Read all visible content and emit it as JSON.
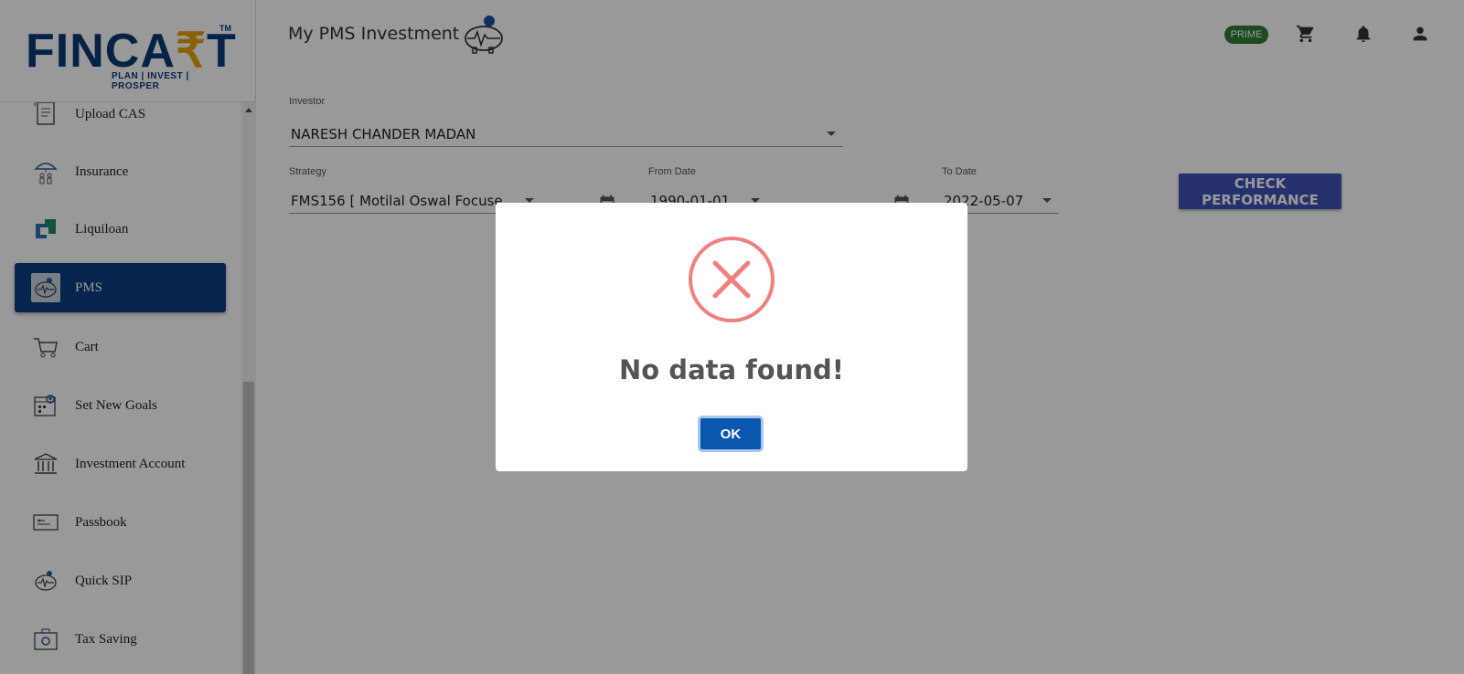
{
  "app": {
    "logo_text_main": "FINCA",
    "logo_text_accent": "₹",
    "logo_text_end": "T",
    "logo_tm": "TM",
    "logo_tagline": "PLAN | INVEST | PROSPER"
  },
  "sidebar": {
    "items": [
      {
        "label": "Upload CAS",
        "icon": "document-upload-icon"
      },
      {
        "label": "Insurance",
        "icon": "umbrella-family-icon"
      },
      {
        "label": "Liquiloan",
        "icon": "liquiloan-icon"
      },
      {
        "label": "PMS",
        "icon": "piggy-bank-icon",
        "active": true
      },
      {
        "label": "Cart",
        "icon": "cart-icon"
      },
      {
        "label": "Set New Goals",
        "icon": "goals-calendar-icon"
      },
      {
        "label": "Investment Account",
        "icon": "bank-icon"
      },
      {
        "label": "Passbook",
        "icon": "passbook-icon"
      },
      {
        "label": "Quick SIP",
        "icon": "piggy-bank-icon"
      },
      {
        "label": "Tax Saving",
        "icon": "tax-saving-icon"
      }
    ]
  },
  "header": {
    "title": "My PMS Investment",
    "prime_badge": "PRIME"
  },
  "form": {
    "investor_label": "Investor",
    "investor_value": "NARESH CHANDER MADAN",
    "strategy_label": "Strategy",
    "strategy_value": "FMS156 [ Motilal Oswal Focuse",
    "from_date_label": "From Date",
    "from_date_value": "1990-01-01",
    "to_date_label": "To Date",
    "to_date_value": "2022-05-07",
    "check_button": "CHECK PERFORMANCE"
  },
  "dialog": {
    "icon": "error-x-icon",
    "title": "No data found!",
    "ok_button": "OK"
  },
  "colors": {
    "brand_navy": "#0b3f7f",
    "brand_gold": "#e6a20a",
    "button_indigo": "#3f51b5",
    "prime_green": "#2e7d32",
    "error_red": "#f08080",
    "ok_blue": "#0b57b0"
  }
}
